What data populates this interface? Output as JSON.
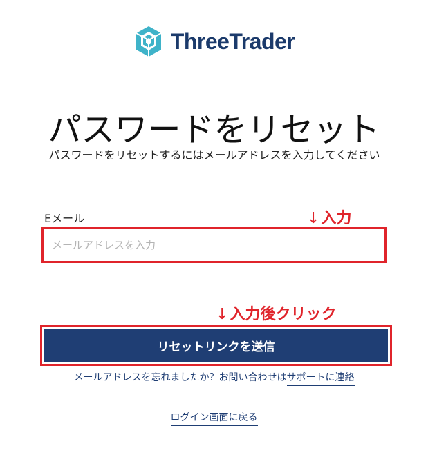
{
  "brand": {
    "name": "ThreeTrader",
    "logo_color": "#3fb3c9",
    "text_color": "#1b3a6b"
  },
  "page": {
    "title": "パスワードをリセット",
    "subtitle": "パスワードをリセットするにはメールアドレスを入力してください"
  },
  "form": {
    "email_label": "Eメール",
    "email_placeholder": "メールアドレスを入力",
    "email_value": "",
    "submit_label": "リセットリンクを送信",
    "button_color": "#1f3e74"
  },
  "annotations": {
    "arrow": "↓",
    "input_note": "入力",
    "click_note": "入力後クリック",
    "color": "#e0242b"
  },
  "help": {
    "text": "メールアドレスを忘れましたか？お問い合わせは",
    "link": "サポートに連絡"
  },
  "back_link": "ログイン画面に戻る"
}
